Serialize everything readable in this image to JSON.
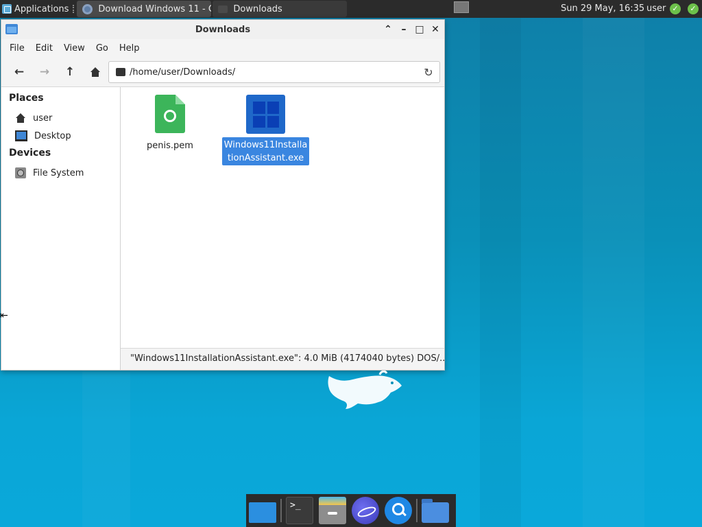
{
  "top_panel": {
    "applications_label": "Applications",
    "tasks": [
      {
        "label": "Download Windows 11 - C..."
      },
      {
        "label": "Downloads"
      }
    ],
    "clock": "Sun 29 May, 16:35",
    "user": "user"
  },
  "window": {
    "title": "Downloads",
    "menu": [
      "File",
      "Edit",
      "View",
      "Go",
      "Help"
    ],
    "location": "/home/user/Downloads/",
    "sidebar": {
      "places_heading": "Places",
      "places": [
        {
          "label": "user",
          "icon": "home-icon"
        },
        {
          "label": "Desktop",
          "icon": "desktop-icon"
        }
      ],
      "devices_heading": "Devices",
      "devices": [
        {
          "label": "File System",
          "icon": "drive-icon"
        }
      ]
    },
    "files": [
      {
        "name": "penis.pem",
        "icon": "certificate-file-icon",
        "selected": false
      },
      {
        "name": "Windows11InstallationAssistant.exe",
        "icon": "windows-executable-icon",
        "selected": true
      }
    ],
    "status": "\"Windows11InstallationAssistant.exe\": 4.0 MiB (4174040 bytes) DOS/..."
  },
  "colors": {
    "selection": "#3a86e0",
    "desktop_bg": "#0aa6d6",
    "panel_bg": "#2b2b2b"
  }
}
